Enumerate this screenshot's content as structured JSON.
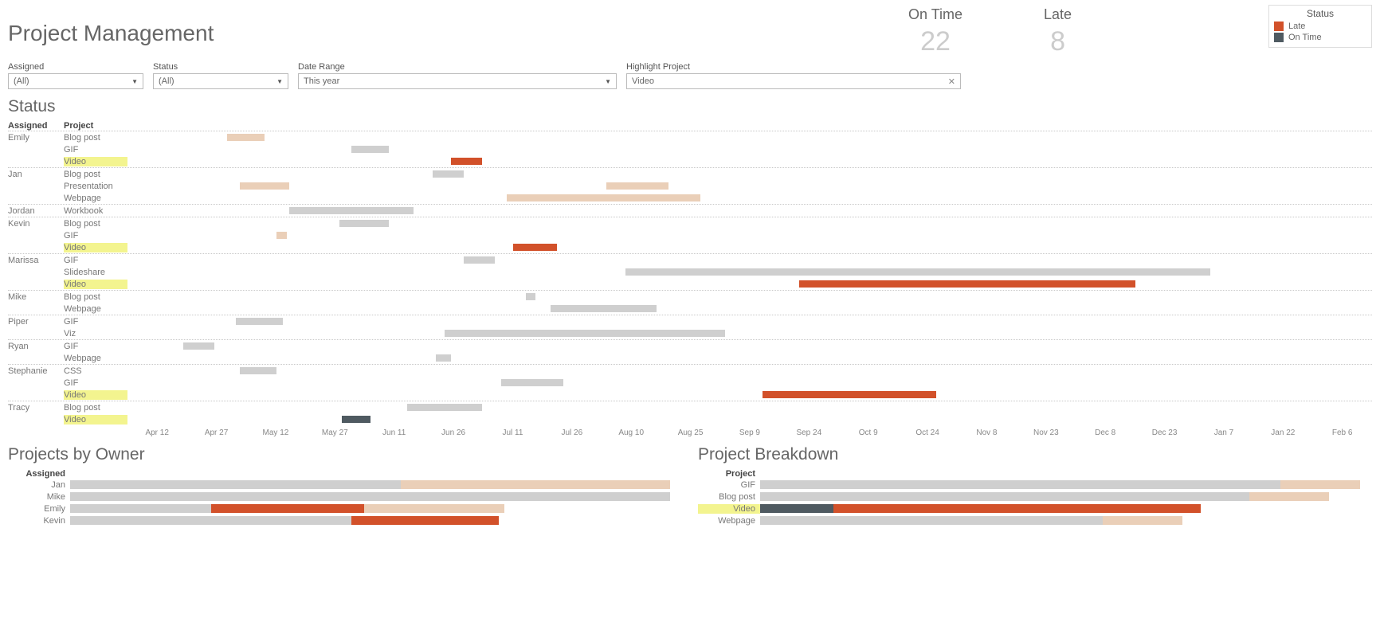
{
  "title": "Project Management",
  "kpis": {
    "on_time_label": "On Time",
    "on_time_value": "22",
    "late_label": "Late",
    "late_value": "8"
  },
  "legend": {
    "title": "Status",
    "items": [
      {
        "label": "Late",
        "color": "#d2512a"
      },
      {
        "label": "On Time",
        "color": "#4f5a61"
      }
    ]
  },
  "filters": {
    "assigned_label": "Assigned",
    "assigned_value": "(All)",
    "status_label": "Status",
    "status_value": "(All)",
    "daterange_label": "Date Range",
    "daterange_value": "This year",
    "highlight_label": "Highlight Project",
    "highlight_value": "Video"
  },
  "status_section_title": "Status",
  "gantt_col_assigned": "Assigned",
  "gantt_col_project": "Project",
  "chart_data": {
    "gantt": {
      "type": "gantt",
      "x_domain": [
        "Apr 12",
        "Feb 6"
      ],
      "x_ticks": [
        "Apr 12",
        "Apr 27",
        "May 12",
        "May 27",
        "Jun 11",
        "Jun 26",
        "Jul 11",
        "Jul 26",
        "Aug 10",
        "Aug 25",
        "Sep 9",
        "Sep 24",
        "Oct 9",
        "Oct 24",
        "Nov 8",
        "Nov 23",
        "Dec 8",
        "Dec 23",
        "Jan 7",
        "Jan 22",
        "Feb 6"
      ],
      "highlight_project": "Video",
      "groups": [
        {
          "assigned": "Emily",
          "rows": [
            {
              "project": "Blog post",
              "bars": [
                {
                  "start_pct": 8,
                  "end_pct": 11,
                  "color": "tan"
                }
              ]
            },
            {
              "project": "GIF",
              "bars": [
                {
                  "start_pct": 18,
                  "end_pct": 21,
                  "color": "grey"
                }
              ]
            },
            {
              "project": "Video",
              "bars": [
                {
                  "start_pct": 26,
                  "end_pct": 28.5,
                  "color": "orange"
                }
              ],
              "highlight": true
            }
          ]
        },
        {
          "assigned": "Jan",
          "rows": [
            {
              "project": "Blog post",
              "bars": [
                {
                  "start_pct": 24.5,
                  "end_pct": 27,
                  "color": "grey"
                }
              ]
            },
            {
              "project": "Presentation",
              "bars": [
                {
                  "start_pct": 9,
                  "end_pct": 13,
                  "color": "tan"
                },
                {
                  "start_pct": 38.5,
                  "end_pct": 43.5,
                  "color": "tan"
                }
              ]
            },
            {
              "project": "Webpage",
              "bars": [
                {
                  "start_pct": 30.5,
                  "end_pct": 46,
                  "color": "tan"
                }
              ]
            }
          ]
        },
        {
          "assigned": "Jordan",
          "rows": [
            {
              "project": "Workbook",
              "bars": [
                {
                  "start_pct": 13,
                  "end_pct": 23,
                  "color": "grey"
                }
              ]
            }
          ]
        },
        {
          "assigned": "Kevin",
          "rows": [
            {
              "project": "Blog post",
              "bars": [
                {
                  "start_pct": 17,
                  "end_pct": 21,
                  "color": "grey"
                }
              ]
            },
            {
              "project": "GIF",
              "bars": [
                {
                  "start_pct": 12,
                  "end_pct": 12.8,
                  "color": "tan"
                }
              ]
            },
            {
              "project": "Video",
              "bars": [
                {
                  "start_pct": 31,
                  "end_pct": 34.5,
                  "color": "orange"
                }
              ],
              "highlight": true
            }
          ]
        },
        {
          "assigned": "Marissa",
          "rows": [
            {
              "project": "GIF",
              "bars": [
                {
                  "start_pct": 27,
                  "end_pct": 29.5,
                  "color": "grey"
                }
              ]
            },
            {
              "project": "Slideshare",
              "bars": [
                {
                  "start_pct": 40,
                  "end_pct": 87,
                  "color": "grey"
                }
              ]
            },
            {
              "project": "Video",
              "bars": [
                {
                  "start_pct": 54,
                  "end_pct": 81,
                  "color": "orange"
                }
              ],
              "highlight": true
            }
          ]
        },
        {
          "assigned": "Mike",
          "rows": [
            {
              "project": "Blog post",
              "bars": [
                {
                  "start_pct": 32,
                  "end_pct": 32.8,
                  "color": "grey"
                }
              ]
            },
            {
              "project": "Webpage",
              "bars": [
                {
                  "start_pct": 34,
                  "end_pct": 42.5,
                  "color": "grey"
                }
              ]
            }
          ]
        },
        {
          "assigned": "Piper",
          "rows": [
            {
              "project": "GIF",
              "bars": [
                {
                  "start_pct": 8.7,
                  "end_pct": 12.5,
                  "color": "grey"
                }
              ]
            },
            {
              "project": "Viz",
              "bars": [
                {
                  "start_pct": 25.5,
                  "end_pct": 48,
                  "color": "grey"
                }
              ]
            }
          ]
        },
        {
          "assigned": "Ryan",
          "rows": [
            {
              "project": "GIF",
              "bars": [
                {
                  "start_pct": 4.5,
                  "end_pct": 7,
                  "color": "grey"
                }
              ]
            },
            {
              "project": "Webpage",
              "bars": [
                {
                  "start_pct": 24.8,
                  "end_pct": 26,
                  "color": "grey"
                }
              ]
            }
          ]
        },
        {
          "assigned": "Stephanie",
          "rows": [
            {
              "project": "CSS",
              "bars": [
                {
                  "start_pct": 9,
                  "end_pct": 12,
                  "color": "grey"
                }
              ]
            },
            {
              "project": "GIF",
              "bars": [
                {
                  "start_pct": 30,
                  "end_pct": 35,
                  "color": "grey"
                }
              ]
            },
            {
              "project": "Video",
              "bars": [
                {
                  "start_pct": 51,
                  "end_pct": 65,
                  "color": "orange"
                }
              ],
              "highlight": true
            }
          ]
        },
        {
          "assigned": "Tracy",
          "rows": [
            {
              "project": "Blog post",
              "bars": [
                {
                  "start_pct": 22.5,
                  "end_pct": 28.5,
                  "color": "grey"
                }
              ]
            },
            {
              "project": "Video",
              "bars": [
                {
                  "start_pct": 17.2,
                  "end_pct": 19.5,
                  "color": "dark"
                }
              ],
              "highlight": true
            }
          ]
        }
      ]
    },
    "projects_by_owner": {
      "type": "bar",
      "title": "Projects by Owner",
      "header": "Assigned",
      "rows": [
        {
          "label": "Jan",
          "segments": [
            {
              "w_pct": 54,
              "color": "grey"
            },
            {
              "w_pct": 44,
              "color": "tan"
            }
          ]
        },
        {
          "label": "Mike",
          "segments": [
            {
              "w_pct": 98,
              "color": "grey"
            }
          ]
        },
        {
          "label": "Emily",
          "segments": [
            {
              "w_pct": 23,
              "color": "grey"
            },
            {
              "w_pct": 25,
              "color": "orange"
            },
            {
              "w_pct": 23,
              "color": "tan"
            }
          ]
        },
        {
          "label": "Kevin",
          "segments": [
            {
              "w_pct": 46,
              "color": "grey"
            },
            {
              "w_pct": 24,
              "color": "orange"
            }
          ]
        }
      ]
    },
    "project_breakdown": {
      "type": "bar",
      "title": "Project Breakdown",
      "header": "Project",
      "rows": [
        {
          "label": "GIF",
          "segments": [
            {
              "w_pct": 85,
              "color": "grey"
            },
            {
              "w_pct": 13,
              "color": "tan"
            }
          ]
        },
        {
          "label": "Blog post",
          "segments": [
            {
              "w_pct": 80,
              "color": "grey"
            },
            {
              "w_pct": 13,
              "color": "tan"
            }
          ]
        },
        {
          "label": "Video",
          "highlight": true,
          "segments": [
            {
              "w_pct": 12,
              "color": "dark"
            },
            {
              "w_pct": 60,
              "color": "orange"
            }
          ]
        },
        {
          "label": "Webpage",
          "segments": [
            {
              "w_pct": 56,
              "color": "grey"
            },
            {
              "w_pct": 13,
              "color": "tan"
            }
          ]
        }
      ]
    }
  },
  "colors": {
    "grey": "#cfcfcf",
    "tan": "#eacfb8",
    "orange": "#d2512a",
    "dark": "#4f5a61"
  }
}
